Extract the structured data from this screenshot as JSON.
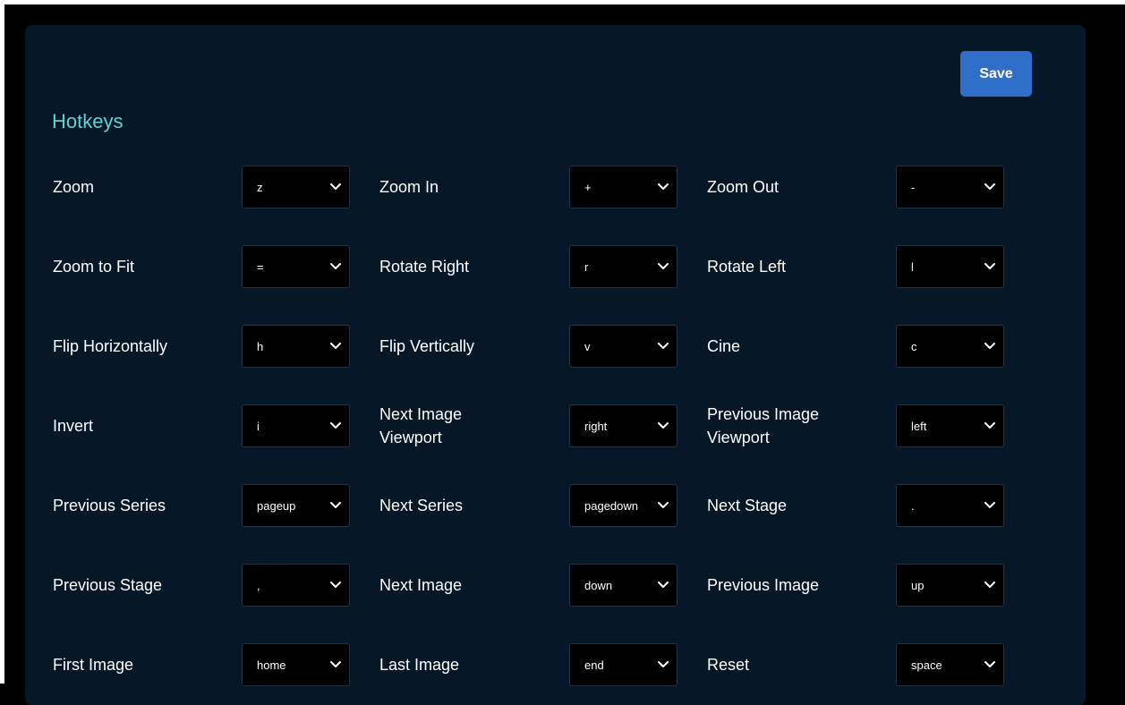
{
  "save_label": "Save",
  "section_title": "Hotkeys",
  "colors": {
    "panel_bg": "#061828",
    "accent_title": "#5fd3d3",
    "save_button": "#2f6fc9",
    "select_bg": "#000000"
  },
  "rows": [
    [
      {
        "label_lines": [
          "Zoom"
        ],
        "value": "z"
      },
      {
        "label_lines": [
          "Zoom In"
        ],
        "value": "+"
      },
      {
        "label_lines": [
          "Zoom Out"
        ],
        "value": "-"
      }
    ],
    [
      {
        "label_lines": [
          "Zoom to Fit"
        ],
        "value": "="
      },
      {
        "label_lines": [
          "Rotate Right"
        ],
        "value": "r"
      },
      {
        "label_lines": [
          "Rotate Left"
        ],
        "value": "l"
      }
    ],
    [
      {
        "label_lines": [
          "Flip Horizontally"
        ],
        "value": "h"
      },
      {
        "label_lines": [
          "Flip Vertically"
        ],
        "value": "v"
      },
      {
        "label_lines": [
          "Cine"
        ],
        "value": "c"
      }
    ],
    [
      {
        "label_lines": [
          "Invert"
        ],
        "value": "i"
      },
      {
        "label_lines": [
          "Next Image",
          "Viewport"
        ],
        "value": "right"
      },
      {
        "label_lines": [
          "Previous Image",
          "Viewport"
        ],
        "value": "left"
      }
    ],
    [
      {
        "label_lines": [
          "Previous Series"
        ],
        "value": "pageup"
      },
      {
        "label_lines": [
          "Next Series"
        ],
        "value": "pagedown"
      },
      {
        "label_lines": [
          "Next Stage"
        ],
        "value": "."
      }
    ],
    [
      {
        "label_lines": [
          "Previous Stage"
        ],
        "value": ","
      },
      {
        "label_lines": [
          "Next Image"
        ],
        "value": "down"
      },
      {
        "label_lines": [
          "Previous Image"
        ],
        "value": "up"
      }
    ],
    [
      {
        "label_lines": [
          "First Image"
        ],
        "value": "home"
      },
      {
        "label_lines": [
          "Last Image"
        ],
        "value": "end"
      },
      {
        "label_lines": [
          "Reset"
        ],
        "value": "space"
      }
    ]
  ],
  "icons": {
    "dropdown": "chevron-down-icon",
    "cursor": "mouse-pointer-icon"
  }
}
